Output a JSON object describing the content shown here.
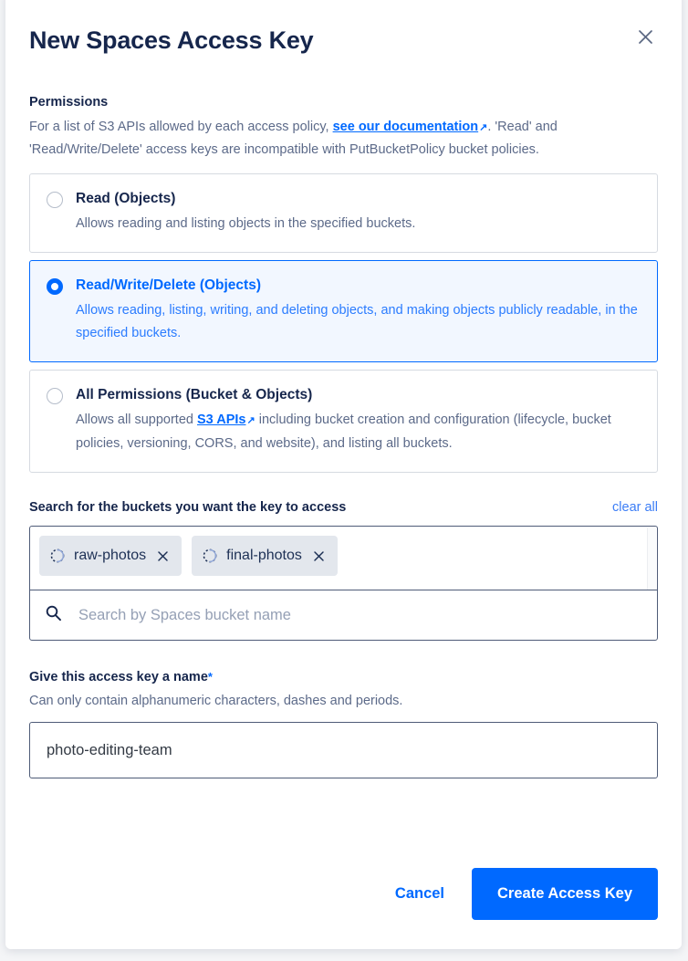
{
  "modal": {
    "title": "New Spaces Access Key",
    "close_icon": "close-icon"
  },
  "permissions": {
    "heading": "Permissions",
    "help_prefix": "For a list of S3 APIs allowed by each access policy, ",
    "help_link": "see our documentation",
    "help_link_arrow": "↗",
    "help_suffix": ". 'Read' and 'Read/Write/Delete' access keys are incompatible with PutBucketPolicy bucket policies.",
    "options": [
      {
        "title": "Read (Objects)",
        "description": "Allows reading and listing objects in the specified buckets.",
        "selected": false
      },
      {
        "title": "Read/Write/Delete (Objects)",
        "description": "Allows reading, listing, writing, and deleting objects, and making objects publicly readable, in the specified buckets.",
        "selected": true
      },
      {
        "title": "All Permissions (Bucket & Objects)",
        "desc_prefix": "Allows all supported ",
        "desc_link": "S3 APIs",
        "desc_link_arrow": "↗",
        "desc_suffix": " including bucket creation and configuration (lifecycle, bucket policies, versioning, CORS, and website), and listing all buckets.",
        "selected": false
      }
    ]
  },
  "buckets": {
    "heading": "Search for the buckets you want the key to access",
    "clear_all": "clear all",
    "chips": [
      {
        "label": "raw-photos",
        "icon": "spaces-bucket-icon",
        "remove_icon": "close-icon"
      },
      {
        "label": "final-photos",
        "icon": "spaces-bucket-icon",
        "remove_icon": "close-icon"
      }
    ],
    "search": {
      "icon": "search-icon",
      "placeholder": "Search by Spaces bucket name",
      "value": ""
    }
  },
  "name_field": {
    "label": "Give this access key a name",
    "required_marker": "*",
    "help": "Can only contain alphanumeric characters, dashes and periods.",
    "value": "photo-editing-team",
    "placeholder": ""
  },
  "footer": {
    "cancel_label": "Cancel",
    "submit_label": "Create Access Key"
  },
  "colors": {
    "accent": "#0069ff",
    "title": "#16264c",
    "muted": "#5c6a89",
    "selected_bg": "#f2f7ff",
    "chip_bg": "#e3e7ed"
  }
}
